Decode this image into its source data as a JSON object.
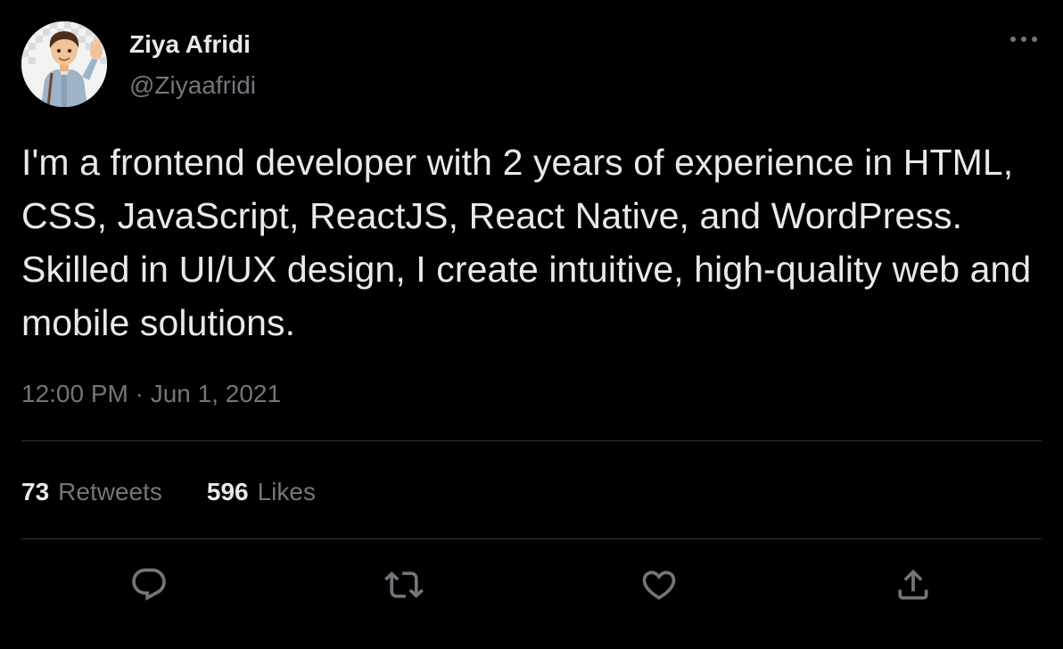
{
  "author": {
    "name": "Ziya Afridi",
    "handle": "@Ziyaafridi",
    "avatar_icon": "user-avatar-illustration"
  },
  "tweet": {
    "text": "I'm a frontend developer with 2 years of experience in HTML, CSS, JavaScript, ReactJS, React Native, and WordPress. Skilled in UI/UX design, I create intuitive, high-quality web and mobile solutions.",
    "timestamp": "12:00 PM · Jun 1, 2021"
  },
  "stats": {
    "retweets_count": "73",
    "retweets_label": "Retweets",
    "likes_count": "596",
    "likes_label": "Likes"
  },
  "actions": {
    "reply_icon": "reply-icon",
    "retweet_icon": "retweet-icon",
    "like_icon": "heart-icon",
    "share_icon": "share-icon",
    "more_icon": "more-options-icon"
  },
  "colors": {
    "background": "#000000",
    "primary_text": "#e7e9ea",
    "secondary_text": "#71767b",
    "divider": "#2f3336"
  }
}
